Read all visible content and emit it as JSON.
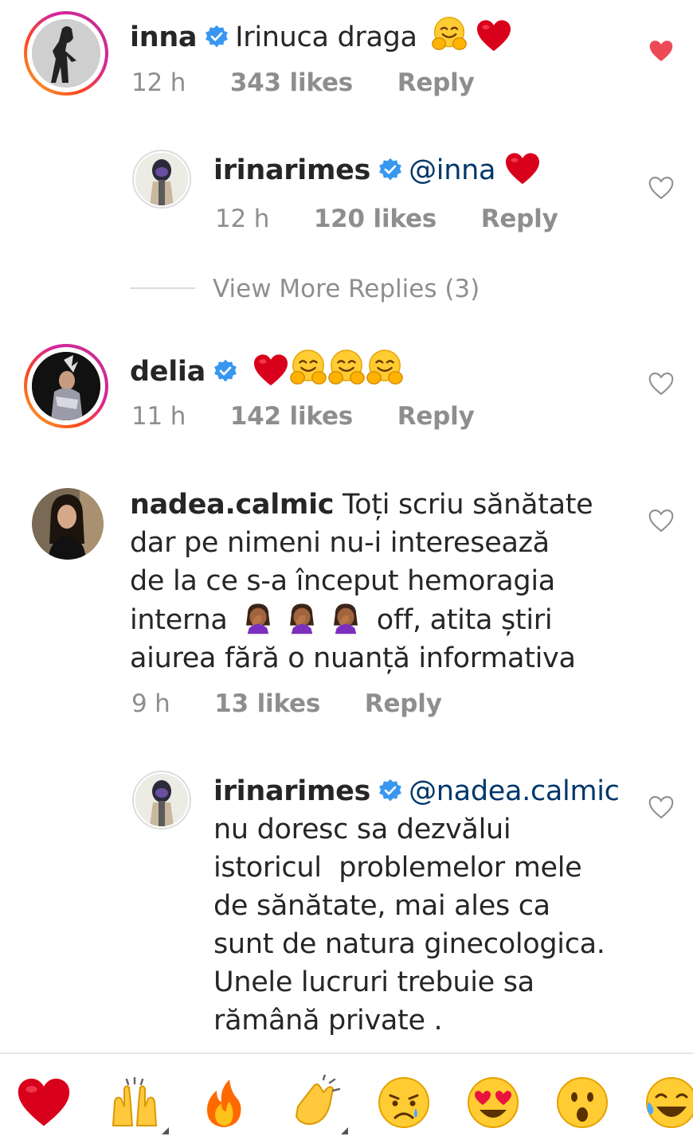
{
  "comments": [
    {
      "username": "inna",
      "text": "Irinuca draga",
      "emojis": [
        "hugging-face",
        "red-heart"
      ],
      "time": "12 h",
      "likes": "343 likes",
      "reply": "Reply",
      "liked": true
    },
    {
      "username": "irinarimes",
      "mention": "@inna",
      "emojis": [
        "red-heart"
      ],
      "time": "12 h",
      "likes": "120 likes",
      "reply": "Reply",
      "liked": false
    },
    {
      "username": "delia",
      "emojis": [
        "red-heart",
        "hugging-face",
        "hugging-face",
        "hugging-face"
      ],
      "time": "11 h",
      "likes": "142 likes",
      "reply": "Reply",
      "liked": false
    },
    {
      "username": "nadea.calmic",
      "text_line1": "Toți scriu sănătate",
      "text_line2": "dar pe nimeni nu-i interesează",
      "text_line3": "de la ce s-a început hemoragia",
      "text_line4a": "interna",
      "text_line4b": "off, atita știri",
      "text_line5": "aiurea fără o nuanță informativa",
      "emojis": [
        "facepalm",
        "facepalm",
        "facepalm"
      ],
      "time": "9 h",
      "likes": "13 likes",
      "reply": "Reply",
      "liked": false
    },
    {
      "username": "irinarimes",
      "mention": "@nadea.calmic",
      "text_line2": "nu doresc sa dezvălui",
      "text_line3": "istoricul  problemelor mele",
      "text_line4": "de sănătate, mai ales ca",
      "text_line5": "sunt de natura ginecologica.",
      "text_line6": "Unele lucruri trebuie sa",
      "text_line7": "rămână private .",
      "liked": false
    }
  ],
  "view_more_replies": "View More Replies (3)",
  "quick_reactions": [
    "red-heart",
    "raising-hands",
    "fire",
    "clapping-hands",
    "crying-face",
    "heart-eyes",
    "astonished-face",
    "tears-of-joy"
  ],
  "colors": {
    "liked_heart": "#ed4956",
    "meta_gray": "#8e8e8e",
    "mention_blue": "#00376b",
    "verified_blue": "#3897f0"
  }
}
